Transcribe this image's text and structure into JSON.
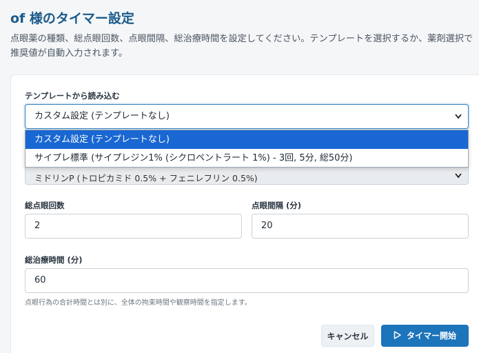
{
  "header": {
    "title": "of 様のタイマー設定",
    "description": "点眼薬の種類、総点眼回数、点眼間隔、総治療時間を設定してください。テンプレートを選択するか、薬剤選択で推奨値が自動入力されます。"
  },
  "template": {
    "label": "テンプレートから読み込む",
    "selected": "カスタム設定 (テンプレートなし)",
    "options": [
      "カスタム設定 (テンプレートなし)",
      "サイプレ標準 (サイプレジン1% (シクロペントラート 1%) - 3回, 5分, 総50分)"
    ]
  },
  "medication": {
    "selected": "ミドリンP (トロピカミド 0.5% + フェニレフリン 0.5%)"
  },
  "total_drops": {
    "label": "総点眼回数",
    "value": "2"
  },
  "interval": {
    "label": "点眼間隔 (分)",
    "value": "20"
  },
  "total_time": {
    "label": "総治療時間 (分)",
    "value": "60",
    "hint": "点眼行為の合計時間とは別に、全体の拘束時間や観察時間を指定します。"
  },
  "buttons": {
    "cancel": "キャンセル",
    "start": "タイマー開始"
  },
  "icons": {
    "chevron": "chevron-down-icon",
    "play": "play-icon"
  },
  "colors": {
    "primary": "#1c74bb",
    "title": "#1a5a8a",
    "dropdown_selected": "#1967d2"
  }
}
